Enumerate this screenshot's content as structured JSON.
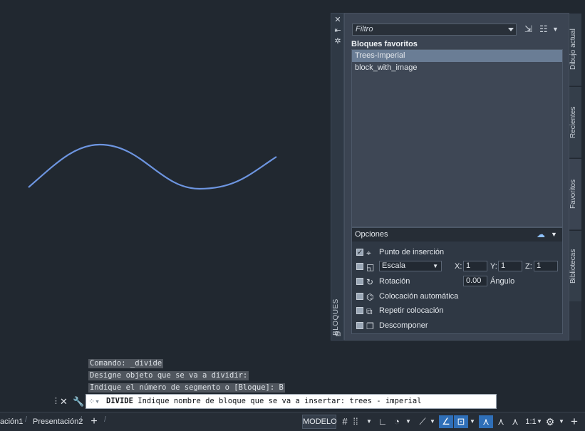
{
  "palette": {
    "title": "BLOQUES",
    "filter_placeholder": "Filtro",
    "favorites_title": "Bloques favoritos",
    "blocks": [
      "Trees-Imperial",
      "block_with_image"
    ],
    "selected_block": "Trees-Imperial",
    "options": {
      "header": "Opciones",
      "insertion_point": "Punto de inserción",
      "scale_select": "Escala",
      "x_label": "X:",
      "x_value": "1",
      "y_label": "Y:",
      "y_value": "1",
      "z_label": "Z:",
      "z_value": "1",
      "rotation": "Rotación",
      "rotation_value": "0.00",
      "angle_label": "Ángulo",
      "auto_placement": "Colocación automática",
      "repeat_placement": "Repetir colocación",
      "explode": "Descomponer"
    },
    "tabs": [
      "Dibujo actual",
      "Recientes",
      "Favoritos",
      "Bibliotecas"
    ],
    "active_tab": "Favoritos"
  },
  "command": {
    "history": [
      "Comando: _divide",
      "Designe objeto que se va a dividir:",
      "Indique el número de segmento o [Bloque]: B"
    ],
    "current_cmd": "DIVIDE",
    "current_prompt": " Indique nombre de bloque que se va a insertar: trees - imperial"
  },
  "statusbar": {
    "layout_tabs": [
      "ación1",
      "Presentación2"
    ],
    "model": "MODELO",
    "scale": "1:1"
  },
  "colors": {
    "canvas": "#212830",
    "curve": "#6d95e0",
    "accent": "#2f6fb8"
  }
}
